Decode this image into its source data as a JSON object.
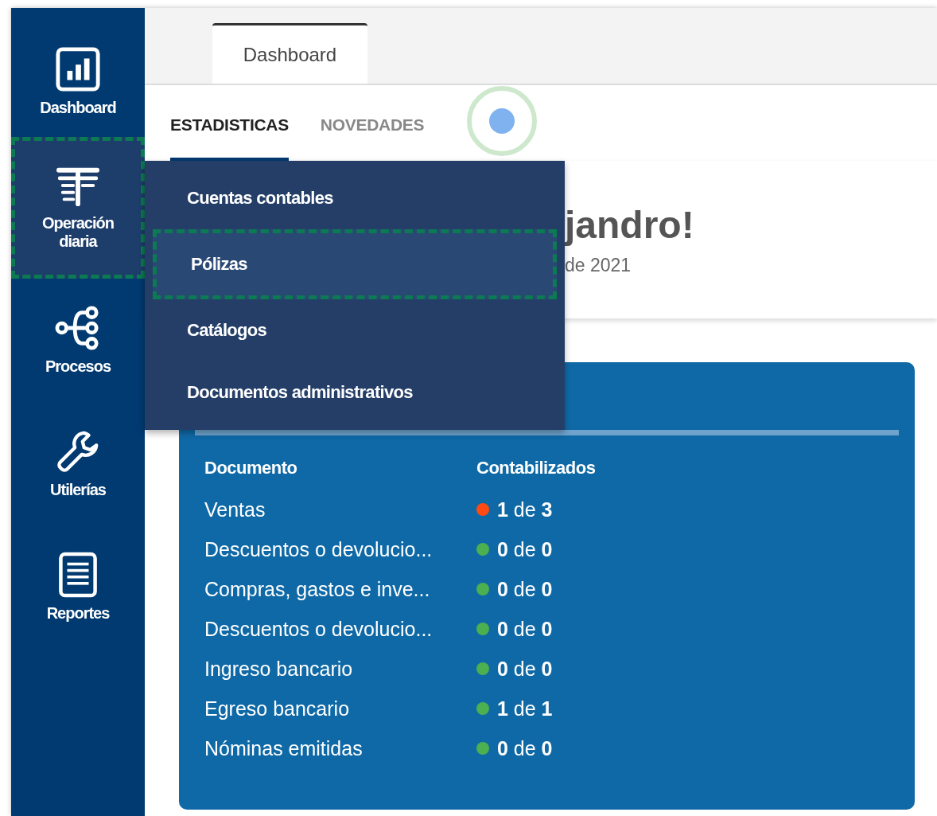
{
  "sidebar": {
    "items": [
      {
        "label": "Dashboard",
        "selected": false,
        "highlighted": false
      },
      {
        "label": "Operación diaria",
        "selected": true,
        "highlighted": true
      },
      {
        "label": "Procesos",
        "selected": false,
        "highlighted": false
      },
      {
        "label": "Utilerías",
        "selected": false,
        "highlighted": false
      },
      {
        "label": "Reportes",
        "selected": false,
        "highlighted": false
      }
    ]
  },
  "page_tabs": [
    {
      "label": "Dashboard",
      "selected": true
    }
  ],
  "sub_tabs": [
    {
      "label": "ESTADISTICAS",
      "selected": true
    },
    {
      "label": "NOVEDADES",
      "selected": false
    }
  ],
  "greeting": {
    "title": "jandro!",
    "subtitle": "de 2021"
  },
  "flyout_menu": {
    "items": [
      {
        "label": "Cuentas contables",
        "highlighted": false
      },
      {
        "label": "Pólizas",
        "highlighted": true
      },
      {
        "label": "Catálogos",
        "highlighted": false
      },
      {
        "label": "Documentos administrativos",
        "highlighted": false
      }
    ]
  },
  "documents_table": {
    "columns": [
      "Documento",
      "Contabilizados"
    ],
    "rows": [
      {
        "document": "Ventas",
        "count": "**1** de **3**",
        "color": "#ff4a12"
      },
      {
        "document": "Descuentos o devolucio...",
        "count": "**0** de **0**",
        "color": "#4caf50"
      },
      {
        "document": "Compras, gastos e inve...",
        "count": "**0** de **0**",
        "color": "#4caf50"
      },
      {
        "document": "Descuentos o devolucio...",
        "count": "**0** de **0**",
        "color": "#4caf50"
      },
      {
        "document": "Ingreso bancario",
        "count": "**0** de **0**",
        "color": "#4caf50"
      },
      {
        "document": "Egreso bancario",
        "count": "**1** de **1**",
        "color": "#4caf50"
      },
      {
        "document": "Nóminas emitidas",
        "count": "**0** de **0**",
        "color": "#4caf50"
      }
    ]
  }
}
